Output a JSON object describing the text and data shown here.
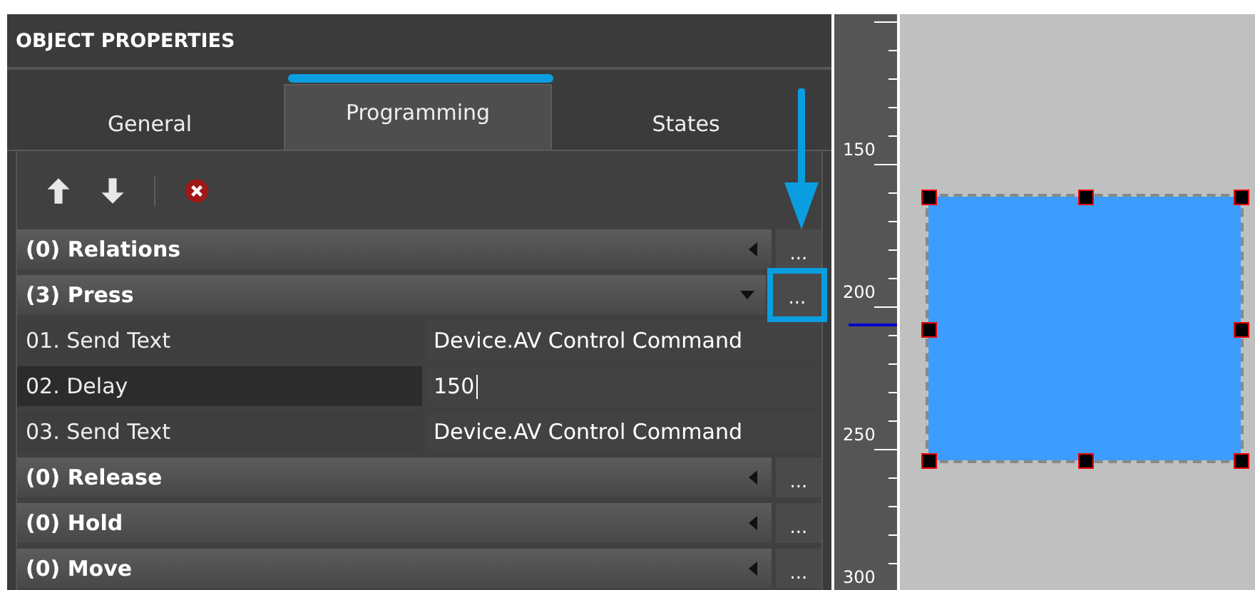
{
  "panel": {
    "title": "OBJECT PROPERTIES"
  },
  "tabs": [
    {
      "label": "General",
      "selected": false
    },
    {
      "label": "Programming",
      "selected": true
    },
    {
      "label": "States",
      "selected": false
    }
  ],
  "sections": [
    {
      "title": "(0) Relations",
      "expanded": false,
      "button": "...",
      "highlighted": false
    },
    {
      "title": "(3) Press",
      "expanded": true,
      "button": "...",
      "highlighted": true,
      "commands": [
        {
          "name": "01. Send Text",
          "value": "Device.AV Control Command",
          "selected": false
        },
        {
          "name": "02. Delay",
          "value": "150",
          "selected": true
        },
        {
          "name": "03. Send Text",
          "value": "Device.AV Control Command",
          "selected": false
        }
      ]
    },
    {
      "title": "(0) Release",
      "expanded": false,
      "button": "...",
      "highlighted": false
    },
    {
      "title": "(0) Hold",
      "expanded": false,
      "button": "...",
      "highlighted": false
    },
    {
      "title": "(0) Move",
      "expanded": false,
      "button": "...",
      "highlighted": false
    }
  ],
  "ruler": {
    "labels": [
      "150",
      "200",
      "250",
      "300"
    ]
  },
  "canvas": {
    "shape": {
      "color": "#3d9dff",
      "selected": true
    }
  }
}
